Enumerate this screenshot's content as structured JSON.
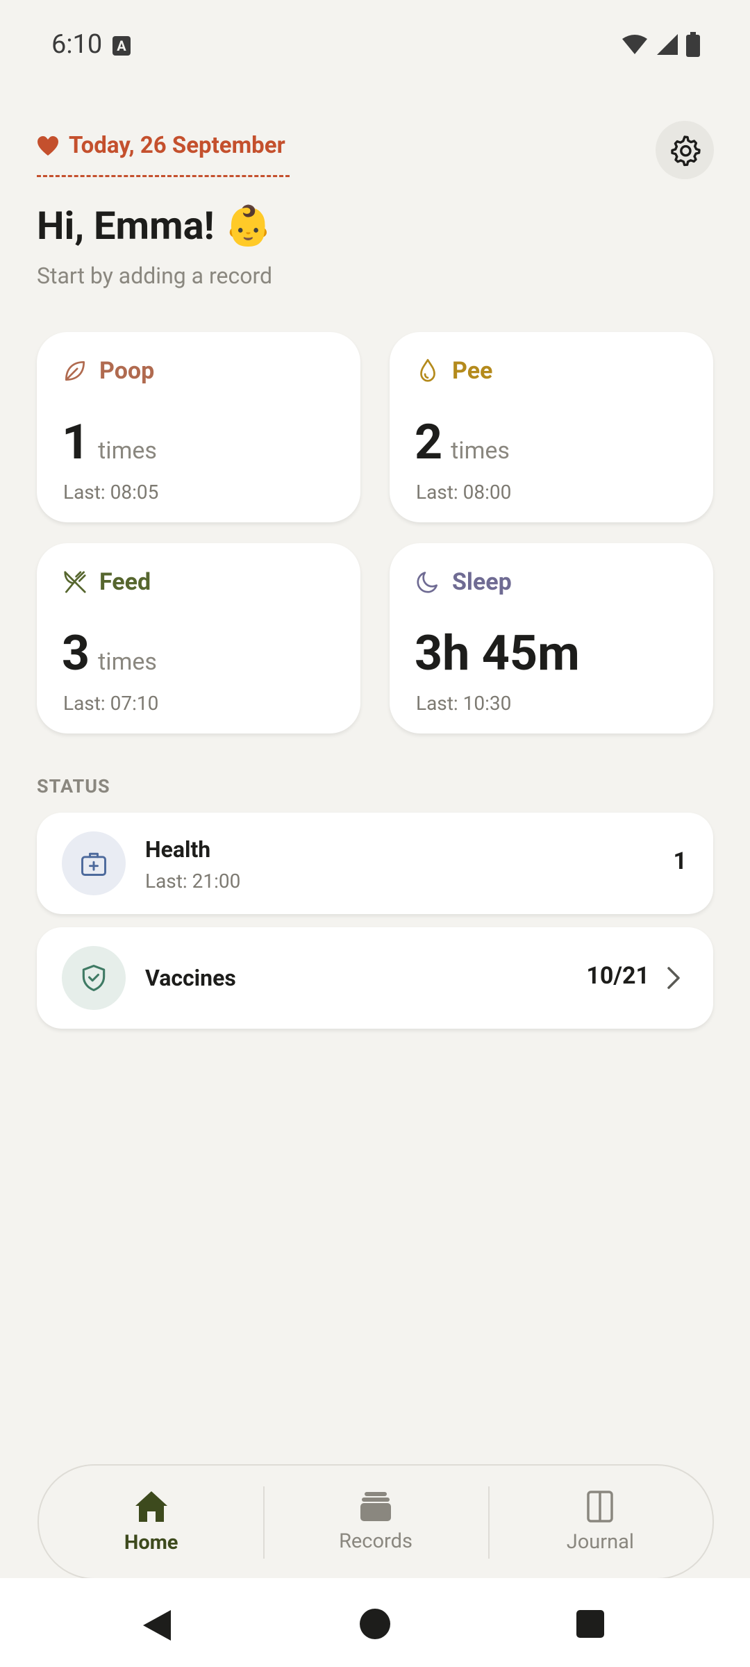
{
  "status_bar": {
    "time": "6:10",
    "notif_badge": "A"
  },
  "header": {
    "date": "Today, 26 September",
    "greeting": "Hi, Emma! 👶",
    "subtitle": "Start by adding a record"
  },
  "cards": {
    "poop": {
      "label": "Poop",
      "value": "1",
      "unit": "times",
      "last": "Last: 08:05",
      "color": "#b06a4f"
    },
    "pee": {
      "label": "Pee",
      "value": "2",
      "unit": "times",
      "last": "Last: 08:00",
      "color": "#b48a1c"
    },
    "feed": {
      "label": "Feed",
      "value": "3",
      "unit": "times",
      "last": "Last: 07:10",
      "color": "#56662e"
    },
    "sleep": {
      "label": "Sleep",
      "value": "3h 45m",
      "last": "Last: 10:30",
      "color": "#6f6b93"
    }
  },
  "status": {
    "label": "STATUS",
    "health": {
      "title": "Health",
      "last": "Last: 21:00",
      "count": "1"
    },
    "vaccines": {
      "title": "Vaccines",
      "count": "10/21"
    }
  },
  "nav": {
    "home": "Home",
    "records": "Records",
    "journal": "Journal"
  },
  "icons": [
    "heart-icon",
    "settings-gear-icon",
    "leaf-icon",
    "droplet-icon",
    "fork-knife-icon",
    "moon-icon",
    "first-aid-kit-icon",
    "shield-check-icon",
    "chevron-right-icon",
    "home-icon",
    "records-stack-icon",
    "journal-book-icon",
    "back-icon",
    "home-circle-icon",
    "recents-square-icon"
  ]
}
